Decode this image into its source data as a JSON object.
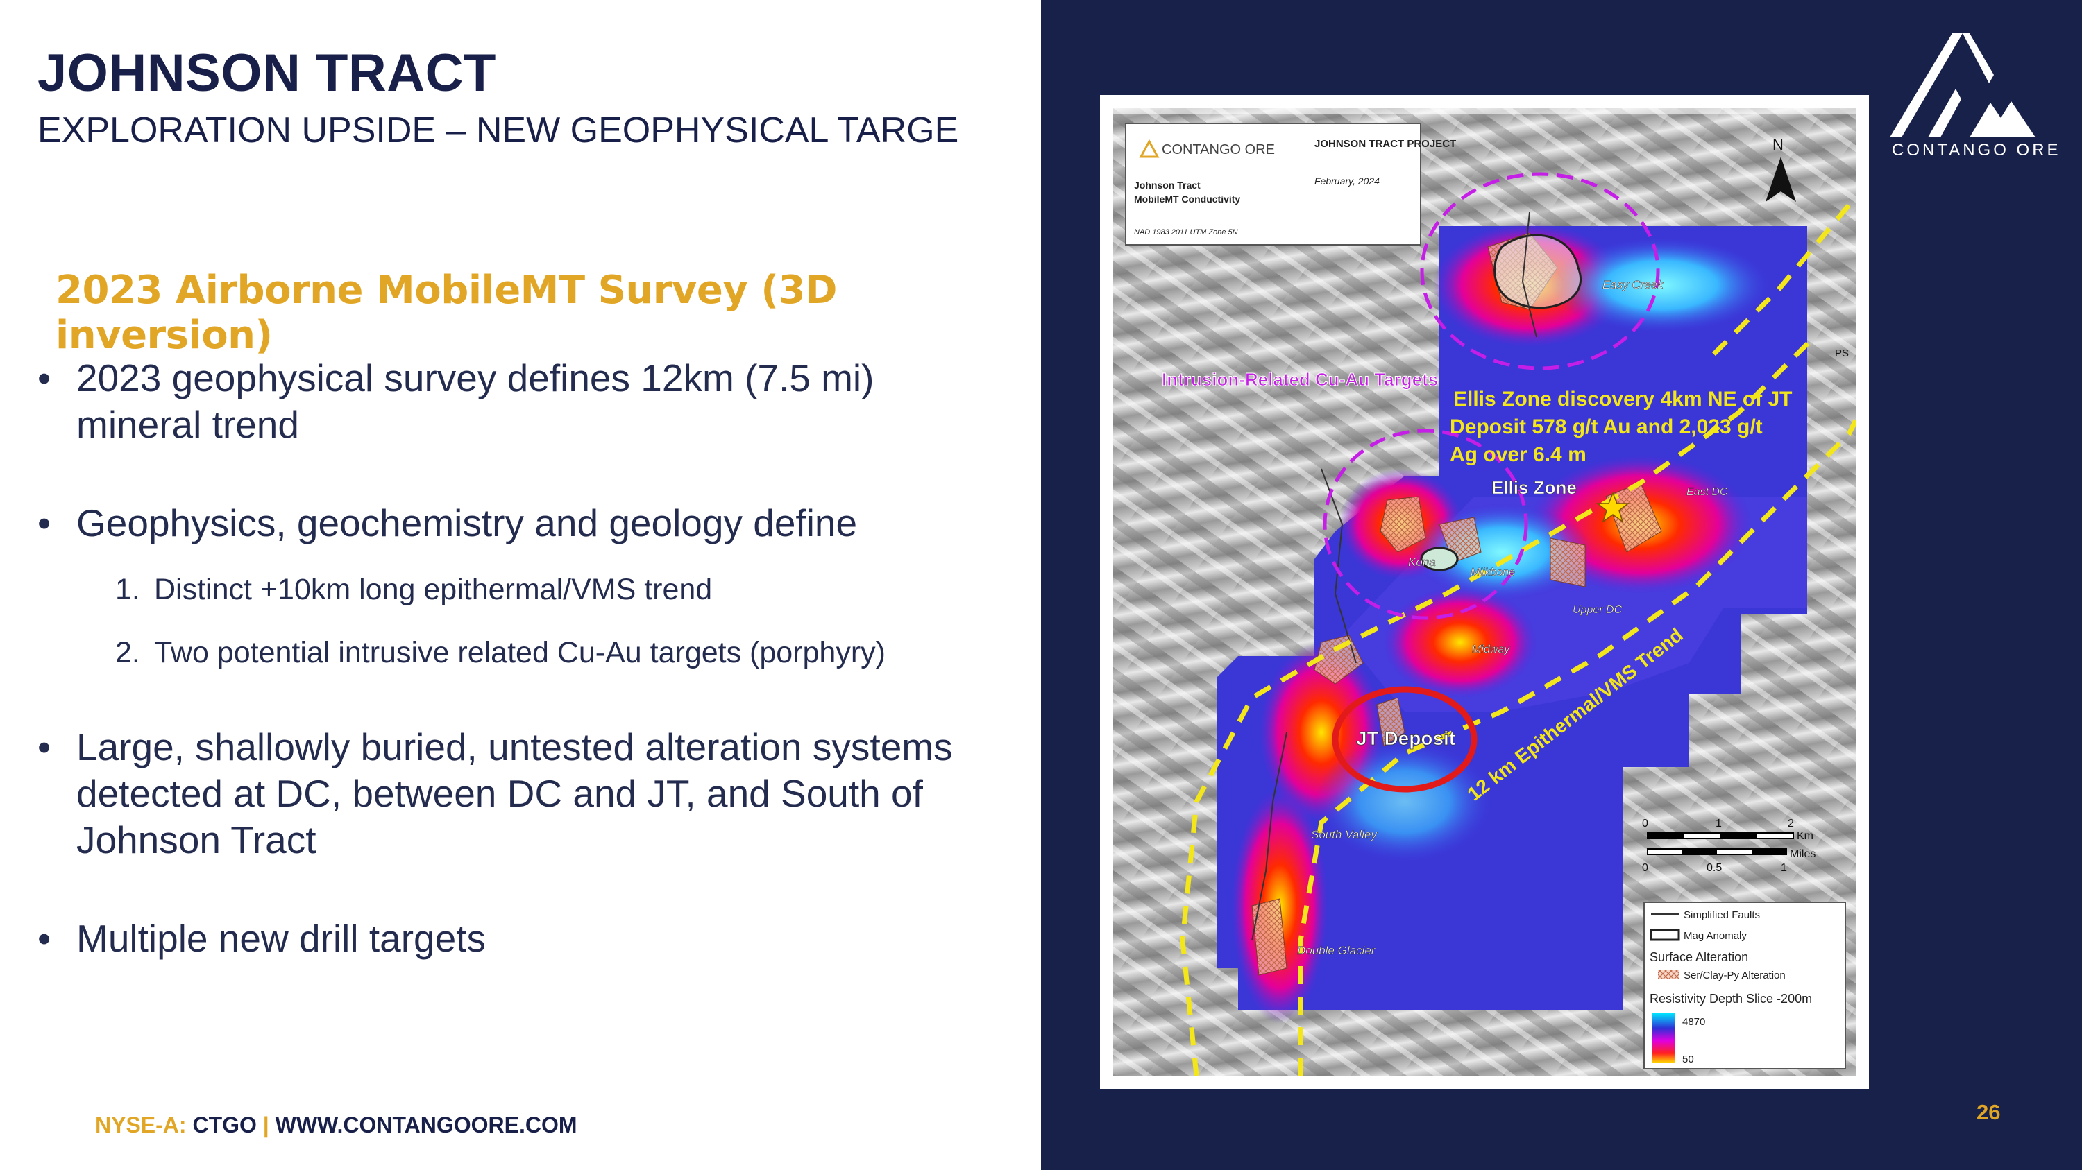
{
  "header": {
    "title": "JOHNSON TRACT",
    "subtitle": "EXPLORATION UPSIDE – NEW GEOPHYSICAL TARGE"
  },
  "section_heading": "2023 Airborne MobileMT Survey (3D inversion)",
  "bullets": [
    {
      "symbol": "•",
      "text": "2023 geophysical survey defines 12km (7.5 mi) mineral trend"
    },
    {
      "symbol": "•",
      "text": "Geophysics, geochemistry and geology define"
    },
    {
      "symbol": "•",
      "text": "Large, shallowly buried, untested alteration systems detected at DC, between DC and JT, and South of Johnson Tract"
    },
    {
      "symbol": "•",
      "text": "Multiple new drill targets"
    }
  ],
  "sub_items": [
    {
      "num": "1.",
      "text": "Distinct +10km long epithermal/VMS trend"
    },
    {
      "num": "2.",
      "text": "Two potential intrusive related Cu-Au targets (porphyry)"
    }
  ],
  "footer": {
    "exchange_label": "NYSE-A:",
    "ticker": "CTGO",
    "separator": "|",
    "website": "WWW.CONTANGOORE.COM"
  },
  "page_number": "26",
  "logo_text": "CONTANGO ORE",
  "map": {
    "title_block": {
      "company": "CONTANGO ORE",
      "project": "JOHNSON TRACT PROJECT",
      "date": "February, 2024",
      "map_name_1": "Johnson Tract",
      "map_name_2": "MobileMT Conductivity",
      "datum": "NAD 1983 2011 UTM Zone 5N"
    },
    "north": "N",
    "targets_label": "Intrusion-Related Cu-Au Targets",
    "ellis_note": [
      "Ellis Zone discovery 4km NE of JT",
      "Deposit 578 g/t Au and 2,023 g/t",
      "Ag over 6.4 m"
    ],
    "ellis_zone": "Ellis Zone",
    "jt_deposit": "JT Deposit",
    "trend_label": "12 km Epithermal/VMS Trend",
    "places": {
      "easy_creek": "Easy Creek",
      "kona": "Kona",
      "milkbone": "Milkbone",
      "east_dc": "East DC",
      "upper_dc": "Upper DC",
      "midway": "Midway",
      "south_valley": "South Valley",
      "double_glacier": "Double Glacier",
      "ps": "PS"
    },
    "scale_km": {
      "ticks": [
        "0",
        "1",
        "2"
      ],
      "unit": "Km"
    },
    "scale_miles": {
      "ticks": [
        "0",
        "0.5",
        "1"
      ],
      "unit": "Miles"
    },
    "legend": {
      "faults": "Simplified Faults",
      "mag": "Mag Anomaly",
      "surface_alteration": "Surface Alteration",
      "alteration_type": "Ser/Clay-Py Alteration",
      "resistivity": "Resistivity Depth Slice -200m",
      "res_high": "4870",
      "res_low": "50"
    },
    "colors": {
      "navy": "#17214a",
      "gold": "#e1a626",
      "yellow": "#f3e61b",
      "magenta": "#c51ee6",
      "red": "#e31a1a"
    }
  }
}
